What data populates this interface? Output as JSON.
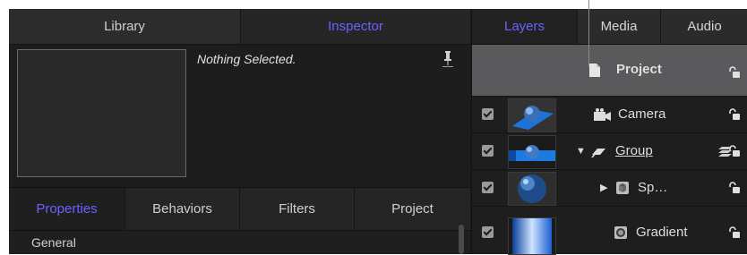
{
  "top_tabs": {
    "library": "Library",
    "inspector": "Inspector"
  },
  "inspector": {
    "nothing_selected": "Nothing Selected."
  },
  "property_tabs": {
    "properties": "Properties",
    "behaviors": "Behaviors",
    "filters": "Filters",
    "project": "Project"
  },
  "section": {
    "general": "General"
  },
  "layer_tabs": {
    "layers": "Layers",
    "media": "Media",
    "audio": "Audio"
  },
  "layers": {
    "project": "Project",
    "camera": "Camera",
    "group": "Group",
    "sphere": "Sp…",
    "gradient": "Gradient"
  },
  "colors": {
    "accent": "#6b61ff",
    "selected_row": "#5a5a5c",
    "panel": "#1f1f20"
  }
}
